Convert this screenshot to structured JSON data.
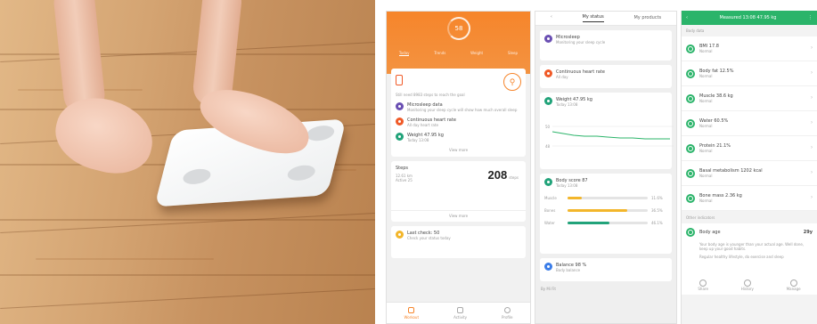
{
  "colors": {
    "orange": "#f6852b",
    "green": "#2bb46a",
    "purple": "#6a4fb3",
    "red_orange": "#f05a28",
    "teal": "#22a37a",
    "blue": "#3b7de8",
    "yellow": "#f3b62b"
  },
  "screen1": {
    "ring_value": "58",
    "tabs": [
      "Today",
      "Trends",
      "Weight",
      "Sleep"
    ],
    "summary_text": "Still need 8983 steps to reach the goal",
    "items": [
      {
        "icon": "sleep-icon",
        "color": "#6a4fb3",
        "title": "Microsleep data",
        "desc": "Monitoring your sleep cycle will show how much overall sleep"
      },
      {
        "icon": "heart-icon",
        "color": "#f05a28",
        "title": "Continuous heart rate",
        "desc": "All day heart rate"
      },
      {
        "icon": "weight-icon",
        "color": "#22a37a",
        "title": "Weight 47.95 kg",
        "desc": "Today  13:08"
      }
    ],
    "view_more": "View more",
    "steps": {
      "label": "Steps",
      "sub1": "12.61 km",
      "sub2": "Active 25",
      "value": "208",
      "unit": "steps"
    },
    "calendar": {
      "title": "Last check: 50",
      "desc": "Check your status today"
    },
    "nav": [
      "Workout",
      "Activity",
      "Profile"
    ]
  },
  "screen2": {
    "tabs": [
      "My status",
      "My products"
    ],
    "items": [
      {
        "icon": "moon-icon",
        "color": "#6a4fb3",
        "title": "Microsleep",
        "desc": "Monitoring your sleep cycle"
      },
      {
        "icon": "heart-icon",
        "color": "#f05a28",
        "title": "Continuous heart rate",
        "desc": "All day"
      }
    ],
    "weight_card": {
      "title": "Weight 47.95 kg",
      "desc": "Today  13:08",
      "axis_labels": [
        "50",
        "48"
      ]
    },
    "body_card": {
      "title": "Body score 87",
      "desc": "Today 13:08"
    },
    "bars": [
      {
        "label": "Muscle",
        "value": 0.18,
        "color": "#f3b62b",
        "text": "11.6%"
      },
      {
        "label": "Bones",
        "value": 0.74,
        "color": "#f3b62b",
        "text": "36.5%"
      },
      {
        "label": "Water",
        "value": 0.52,
        "color": "#22a37a",
        "text": "46.1%"
      }
    ],
    "balance": {
      "title": "Balance 98 %",
      "desc": "Body balance"
    },
    "footer": "By Mi Fit"
  },
  "screen3": {
    "header": "Measured 13:08 47.95 kg",
    "section1": "Body data",
    "metrics": [
      {
        "title": "BMI 17.8",
        "desc": "Normal"
      },
      {
        "title": "Body fat 12.5%",
        "desc": "Normal"
      },
      {
        "title": "Muscle 38.6 kg",
        "desc": "Normal"
      },
      {
        "title": "Water 60.5%",
        "desc": "Normal"
      },
      {
        "title": "Protein 21.1%",
        "desc": "Normal"
      },
      {
        "title": "Basal metabolism 1202 kcal",
        "desc": "Normal"
      },
      {
        "title": "Bone mass 2.36 kg",
        "desc": "Normal"
      }
    ],
    "section2": "Other indicators",
    "body_age": {
      "title": "Body age",
      "value": "29y",
      "desc": "Your body age is younger than your actual age. Well done, keep up your good habits.",
      "tip": "Regular healthy lifestyle, do exercise and sleep"
    },
    "bottom": [
      "Share",
      "History",
      "Manage"
    ]
  }
}
